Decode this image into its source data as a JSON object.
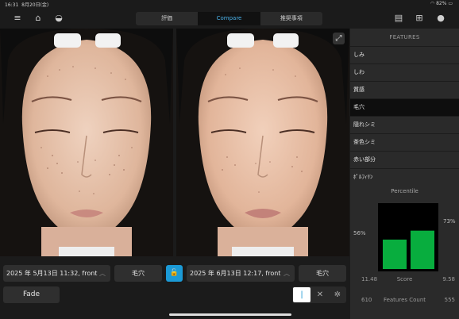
{
  "status": {
    "time": "16:31",
    "date": "8月20日(金)",
    "battery": "82%"
  },
  "tabs": [
    "評価",
    "Compare",
    "推奨事項"
  ],
  "active_tab": "Compare",
  "left_photo": {
    "date": "2025 年 5月13日 11:32, front",
    "mode": "毛穴"
  },
  "right_photo": {
    "date": "2025 年 6月13日 12:17, front",
    "mode": "毛穴"
  },
  "fade_label": "Fade",
  "panel": {
    "header": "FEATURES",
    "features": [
      "しみ",
      "しわ",
      "質感",
      "毛穴",
      "隠れシミ",
      "茶色シミ",
      "赤い部分",
      "ﾎﾟﾙﾌｨﾘﾝ"
    ],
    "active_feature": "毛穴",
    "percentile_title": "Percentile",
    "percentile_left": "56%",
    "percentile_right": "73%",
    "score_label": "Score",
    "score_left": "11.48",
    "score_right": "9.58",
    "count_label": "Features Count",
    "count_left": "610",
    "count_right": "555"
  },
  "chart_data": {
    "type": "bar",
    "categories": [
      "2025年5月13日",
      "2025年6月13日"
    ],
    "values": [
      56,
      73
    ],
    "ylim": [
      0,
      100
    ],
    "colors": [
      "#08ad3e",
      "#08ad3e"
    ]
  },
  "colors": {
    "accent": "#49b0e8",
    "lock": "#1b9ad6",
    "bar": "#08ad3e"
  }
}
